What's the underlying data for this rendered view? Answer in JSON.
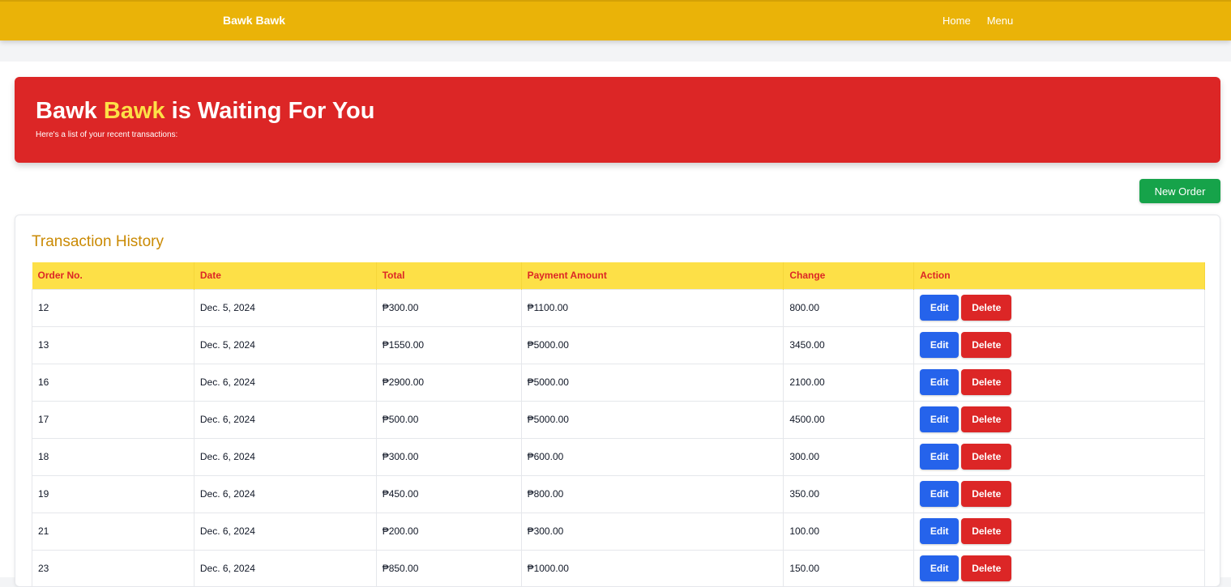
{
  "navbar": {
    "brand": "Bawk Bawk",
    "links": [
      "Home",
      "Menu"
    ]
  },
  "hero": {
    "title_part1": "Bawk ",
    "title_highlight": "Bawk",
    "title_part2": " is Waiting For You",
    "subtitle": "Here's a list of your recent transactions:"
  },
  "actions": {
    "new_order_label": "New Order"
  },
  "transactions": {
    "title": "Transaction History",
    "columns": [
      "Order No.",
      "Date",
      "Total",
      "Payment Amount",
      "Change",
      "Action"
    ],
    "edit_label": "Edit",
    "delete_label": "Delete",
    "rows": [
      {
        "order": "12",
        "date": "Dec. 5, 2024",
        "total": "₱300.00",
        "payment": "₱1100.00",
        "change": "800.00"
      },
      {
        "order": "13",
        "date": "Dec. 5, 2024",
        "total": "₱1550.00",
        "payment": "₱5000.00",
        "change": "3450.00"
      },
      {
        "order": "16",
        "date": "Dec. 6, 2024",
        "total": "₱2900.00",
        "payment": "₱5000.00",
        "change": "2100.00"
      },
      {
        "order": "17",
        "date": "Dec. 6, 2024",
        "total": "₱500.00",
        "payment": "₱5000.00",
        "change": "4500.00"
      },
      {
        "order": "18",
        "date": "Dec. 6, 2024",
        "total": "₱300.00",
        "payment": "₱600.00",
        "change": "300.00"
      },
      {
        "order": "19",
        "date": "Dec. 6, 2024",
        "total": "₱450.00",
        "payment": "₱800.00",
        "change": "350.00"
      },
      {
        "order": "21",
        "date": "Dec. 6, 2024",
        "total": "₱200.00",
        "payment": "₱300.00",
        "change": "100.00"
      },
      {
        "order": "23",
        "date": "Dec. 6, 2024",
        "total": "₱850.00",
        "payment": "₱1000.00",
        "change": "150.00"
      }
    ]
  },
  "colors": {
    "navbar": "#eab308",
    "hero": "#dc2626",
    "highlight": "#fde047",
    "title": "#ca8a04",
    "edit": "#2563eb",
    "delete": "#dc2626",
    "new_order": "#16a34a"
  }
}
